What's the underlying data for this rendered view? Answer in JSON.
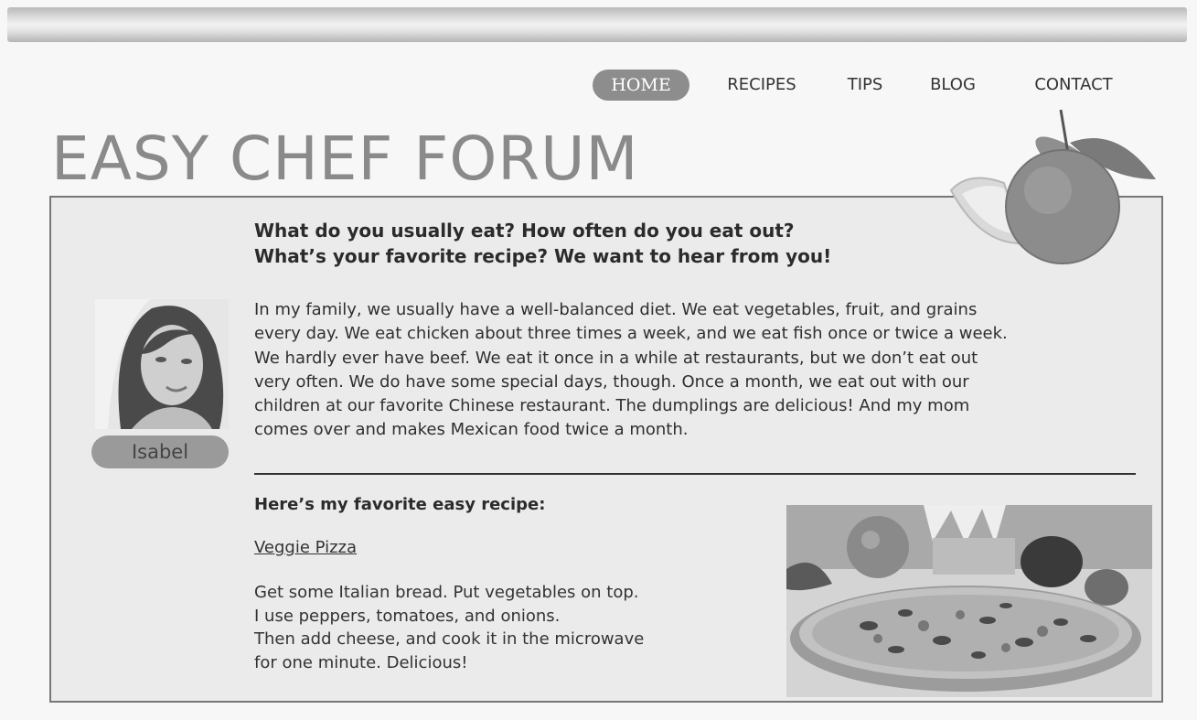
{
  "nav": {
    "items": [
      {
        "label": "HOME",
        "active": true
      },
      {
        "label": "RECIPES",
        "active": false
      },
      {
        "label": "TIPS",
        "active": false
      },
      {
        "label": "BLOG",
        "active": false
      },
      {
        "label": "CONTACT",
        "active": false
      }
    ]
  },
  "site": {
    "title": "EASY CHEF FORUM"
  },
  "post": {
    "question": [
      "What do you usually eat? How often do you eat out?",
      "What’s your favorite recipe? We want to hear from you!"
    ],
    "author": {
      "name": "Isabel"
    },
    "story_lines": [
      "In my family, we usually have a well-balanced diet. We eat vegetables, fruit, and grains",
      "every day. We eat chicken about three times a week, and we eat fish once or twice a week.",
      "We hardly ever have beef. We eat it once in a while at restaurants, but we don’t eat out",
      "very often. We do have some special days, though. Once a month, we eat out with our",
      "children at our favorite Chinese restaurant. The dumplings are delicious! And my mom",
      "comes over and makes Mexican food twice a month."
    ],
    "recipe": {
      "heading": "Here’s my favorite easy recipe:",
      "name": "Veggie Pizza",
      "steps": [
        "Get some Italian bread. Put vegetables on top.",
        "I use peppers, tomatoes, and onions.",
        "Then add cheese, and cook it in the microwave",
        "for one minute. Delicious!"
      ]
    }
  },
  "icons": {
    "decoration": "orange-fruit-icon",
    "avatar": "woman-portrait",
    "food": "pizza-photo"
  }
}
